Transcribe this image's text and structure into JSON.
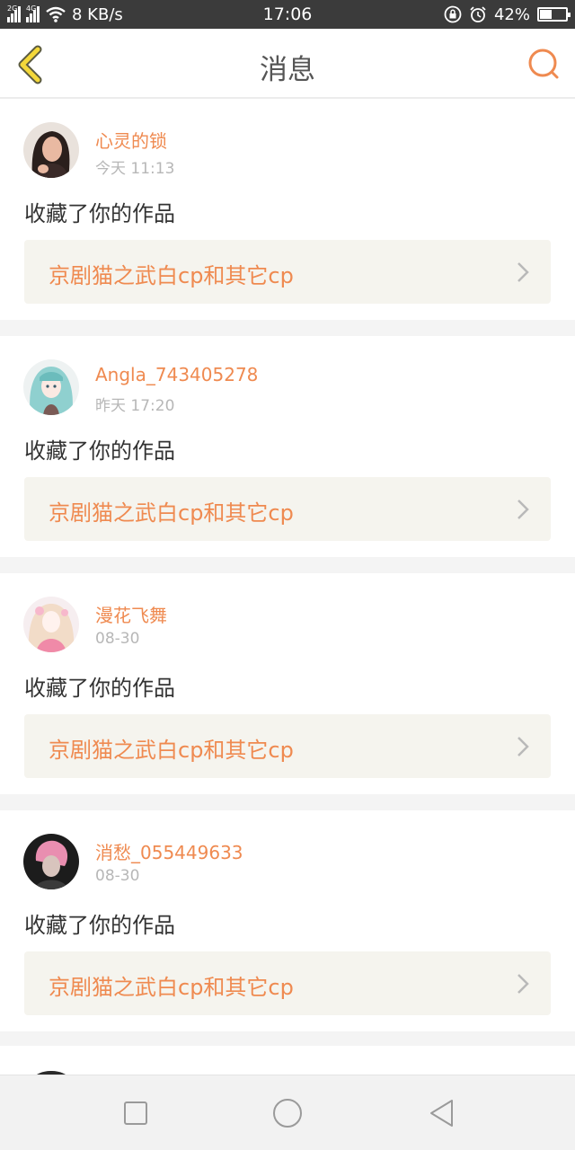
{
  "status_bar": {
    "net_speed": "8 KB/s",
    "time": "17:06",
    "battery": "42%",
    "sim1_tag": "2G",
    "sim2_tag": "4G",
    "battery_level": 0.42
  },
  "header": {
    "title": "消息",
    "back_icon": "chevron-left-icon",
    "search_icon": "search-icon",
    "accent": "#ef8a50"
  },
  "messages": [
    {
      "user": "心灵的锁",
      "time": "今天 11:13",
      "action": "收藏了你的作品",
      "work_title": "京剧猫之武白cp和其它cp"
    },
    {
      "user": "Angla_743405278",
      "time": "昨天 17:20",
      "action": "收藏了你的作品",
      "work_title": "京剧猫之武白cp和其它cp"
    },
    {
      "user": "漫花飞舞",
      "time": "08-30",
      "action": "收藏了你的作品",
      "work_title": "京剧猫之武白cp和其它cp"
    },
    {
      "user": "消愁_055449633",
      "time": "08-30",
      "action": "收藏了你的作品",
      "work_title": "京剧猫之武白cp和其它cp"
    }
  ],
  "navbar": {
    "icons": [
      "square-recents-icon",
      "circle-home-icon",
      "triangle-back-icon"
    ]
  }
}
